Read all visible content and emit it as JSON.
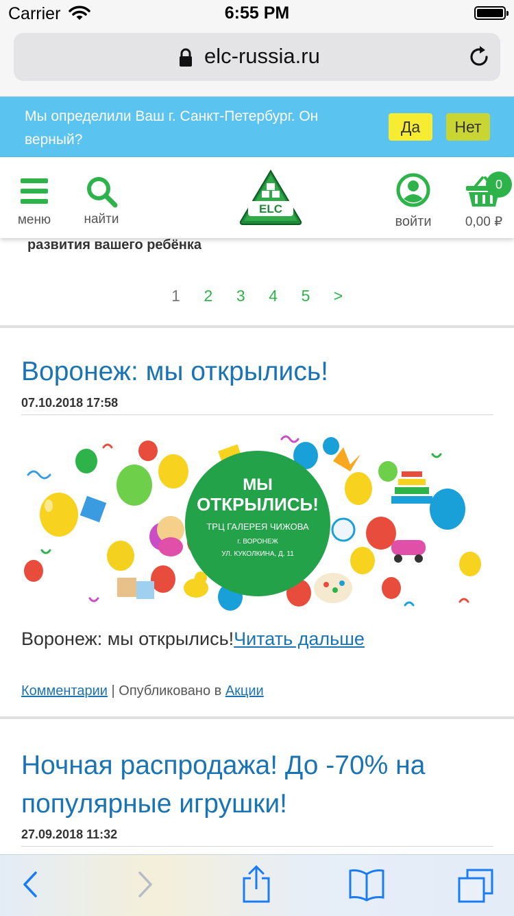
{
  "status_bar": {
    "carrier": "Carrier",
    "time": "6:55 PM"
  },
  "browser": {
    "url": "elc-russia.ru"
  },
  "city_banner": {
    "text": "Мы определили Ваш г. Санкт-Петербург. Он верный?",
    "yes_label": "Да",
    "no_label": "Нет",
    "colors": {
      "background": "#5bc3ef",
      "yes": "#f6ec31",
      "no": "#c9d533"
    }
  },
  "header": {
    "menu_label": "меню",
    "search_label": "найти",
    "login_label": "войти",
    "cart_count": "0",
    "cart_total": "0,00 ₽",
    "logo_text": "ELC",
    "accent_color": "#2db34a"
  },
  "previous_post": {
    "teaser": "развития вашего ребёнка"
  },
  "pagination": {
    "pages": [
      "1",
      "2",
      "3",
      "4",
      "5"
    ],
    "next": ">",
    "current": "1"
  },
  "posts": [
    {
      "title": "Воронеж: мы открылись!",
      "date": "07.10.2018 17:58",
      "image": {
        "headline_line1": "МЫ",
        "headline_line2": "ОТКРЫЛИСЬ!",
        "mall": "ТРЦ ГАЛЕРЕЯ ЧИЖОВА",
        "city": "г. ВОРОНЕЖ",
        "address": "УЛ. КУКОЛКИНА, Д. 11"
      },
      "excerpt": "Воронеж: мы открылись!",
      "read_more": "Читать дальше",
      "comments_link": "Комментарии",
      "published_in": " | Опубликовано в ",
      "category_link": "Акции"
    },
    {
      "title": "Ночная распродажа! До -70% на популярные игрушки!",
      "date": "27.09.2018 11:32"
    }
  ],
  "toolbar": {
    "icons": [
      "back-icon",
      "forward-icon",
      "share-icon",
      "bookmarks-icon",
      "tabs-icon"
    ],
    "tint": "#1a7cf5"
  }
}
